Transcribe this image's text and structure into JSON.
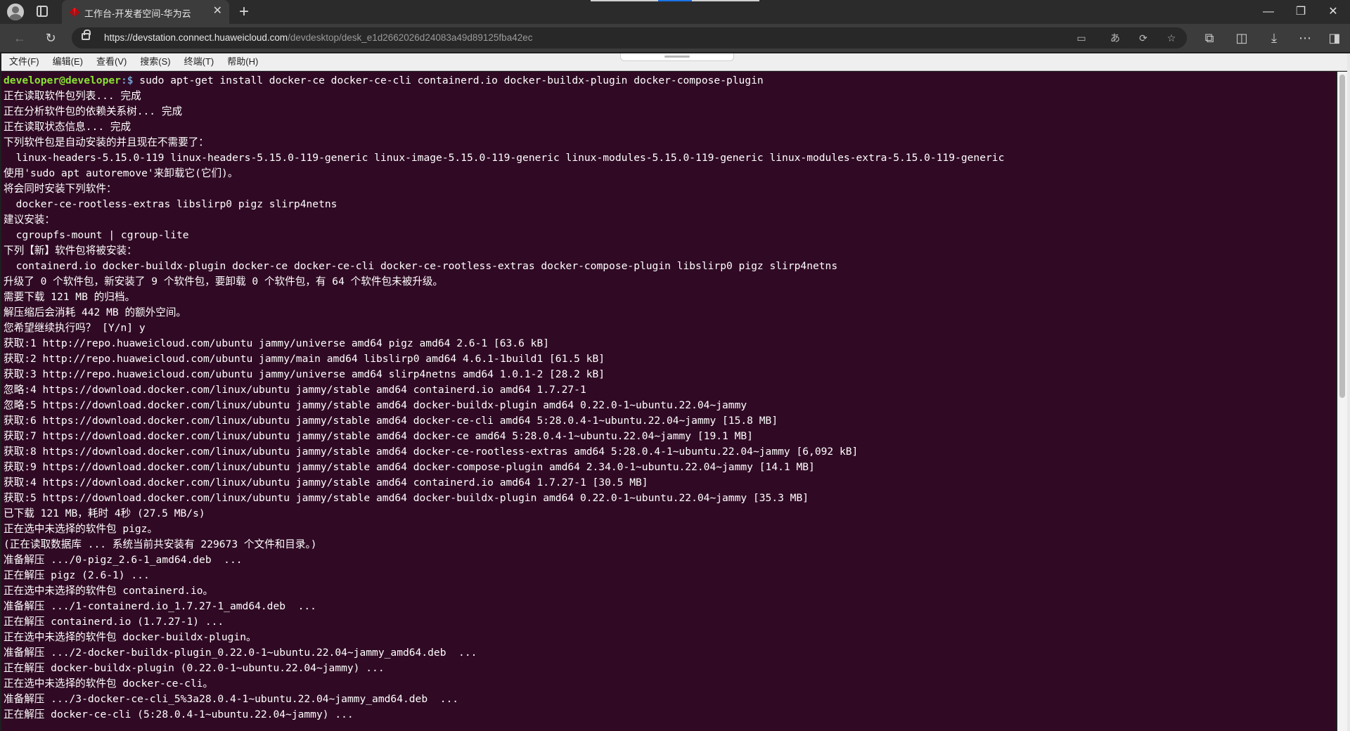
{
  "browser": {
    "tab_title": "工作台-开发者空间-华为云",
    "url_host": "https://devstation.connect.huaweicloud.com",
    "url_path": "/devdesktop/desk_e1d2662026d24083a49d89125fba42ec",
    "favicon_color": "#c7000b"
  },
  "menu": {
    "items": [
      "文件(F)",
      "编辑(E)",
      "查看(V)",
      "搜索(S)",
      "终端(T)",
      "帮助(H)"
    ]
  },
  "terminal": {
    "prompt_user": "developer@developer",
    "prompt_path": ":$",
    "command": " sudo apt-get install docker-ce docker-ce-cli containerd.io docker-buildx-plugin docker-compose-plugin",
    "background": "#300a24",
    "lines": [
      "正在读取软件包列表... 完成",
      "正在分析软件包的依赖关系树... 完成",
      "正在读取状态信息... 完成",
      "下列软件包是自动安装的并且现在不需要了：",
      "  linux-headers-5.15.0-119 linux-headers-5.15.0-119-generic linux-image-5.15.0-119-generic linux-modules-5.15.0-119-generic linux-modules-extra-5.15.0-119-generic",
      "使用'sudo apt autoremove'来卸载它(它们)。",
      "将会同时安装下列软件：",
      "  docker-ce-rootless-extras libslirp0 pigz slirp4netns",
      "建议安装：",
      "  cgroupfs-mount | cgroup-lite",
      "下列【新】软件包将被安装：",
      "  containerd.io docker-buildx-plugin docker-ce docker-ce-cli docker-ce-rootless-extras docker-compose-plugin libslirp0 pigz slirp4netns",
      "升级了 0 个软件包，新安装了 9 个软件包，要卸载 0 个软件包，有 64 个软件包未被升级。",
      "需要下载 121 MB 的归档。",
      "解压缩后会消耗 442 MB 的额外空间。",
      "您希望继续执行吗？ [Y/n] y",
      "获取:1 http://repo.huaweicloud.com/ubuntu jammy/universe amd64 pigz amd64 2.6-1 [63.6 kB]",
      "获取:2 http://repo.huaweicloud.com/ubuntu jammy/main amd64 libslirp0 amd64 4.6.1-1build1 [61.5 kB]",
      "获取:3 http://repo.huaweicloud.com/ubuntu jammy/universe amd64 slirp4netns amd64 1.0.1-2 [28.2 kB]",
      "忽略:4 https://download.docker.com/linux/ubuntu jammy/stable amd64 containerd.io amd64 1.7.27-1",
      "忽略:5 https://download.docker.com/linux/ubuntu jammy/stable amd64 docker-buildx-plugin amd64 0.22.0-1~ubuntu.22.04~jammy",
      "获取:6 https://download.docker.com/linux/ubuntu jammy/stable amd64 docker-ce-cli amd64 5:28.0.4-1~ubuntu.22.04~jammy [15.8 MB]",
      "获取:7 https://download.docker.com/linux/ubuntu jammy/stable amd64 docker-ce amd64 5:28.0.4-1~ubuntu.22.04~jammy [19.1 MB]",
      "获取:8 https://download.docker.com/linux/ubuntu jammy/stable amd64 docker-ce-rootless-extras amd64 5:28.0.4-1~ubuntu.22.04~jammy [6,092 kB]",
      "获取:9 https://download.docker.com/linux/ubuntu jammy/stable amd64 docker-compose-plugin amd64 2.34.0-1~ubuntu.22.04~jammy [14.1 MB]",
      "获取:4 https://download.docker.com/linux/ubuntu jammy/stable amd64 containerd.io amd64 1.7.27-1 [30.5 MB]",
      "获取:5 https://download.docker.com/linux/ubuntu jammy/stable amd64 docker-buildx-plugin amd64 0.22.0-1~ubuntu.22.04~jammy [35.3 MB]",
      "已下载 121 MB，耗时 4秒 (27.5 MB/s)",
      "正在选中未选择的软件包 pigz。",
      "(正在读取数据库 ... 系统当前共安装有 229673 个文件和目录。)",
      "准备解压 .../0-pigz_2.6-1_amd64.deb  ...",
      "正在解压 pigz (2.6-1) ...",
      "正在选中未选择的软件包 containerd.io。",
      "准备解压 .../1-containerd.io_1.7.27-1_amd64.deb  ...",
      "正在解压 containerd.io (1.7.27-1) ...",
      "正在选中未选择的软件包 docker-buildx-plugin。",
      "准备解压 .../2-docker-buildx-plugin_0.22.0-1~ubuntu.22.04~jammy_amd64.deb  ...",
      "正在解压 docker-buildx-plugin (0.22.0-1~ubuntu.22.04~jammy) ...",
      "正在选中未选择的软件包 docker-ce-cli。",
      "准备解压 .../3-docker-ce-cli_5%3a28.0.4-1~ubuntu.22.04~jammy_amd64.deb  ...",
      "正在解压 docker-ce-cli (5:28.0.4-1~ubuntu.22.04~jammy) ..."
    ]
  }
}
